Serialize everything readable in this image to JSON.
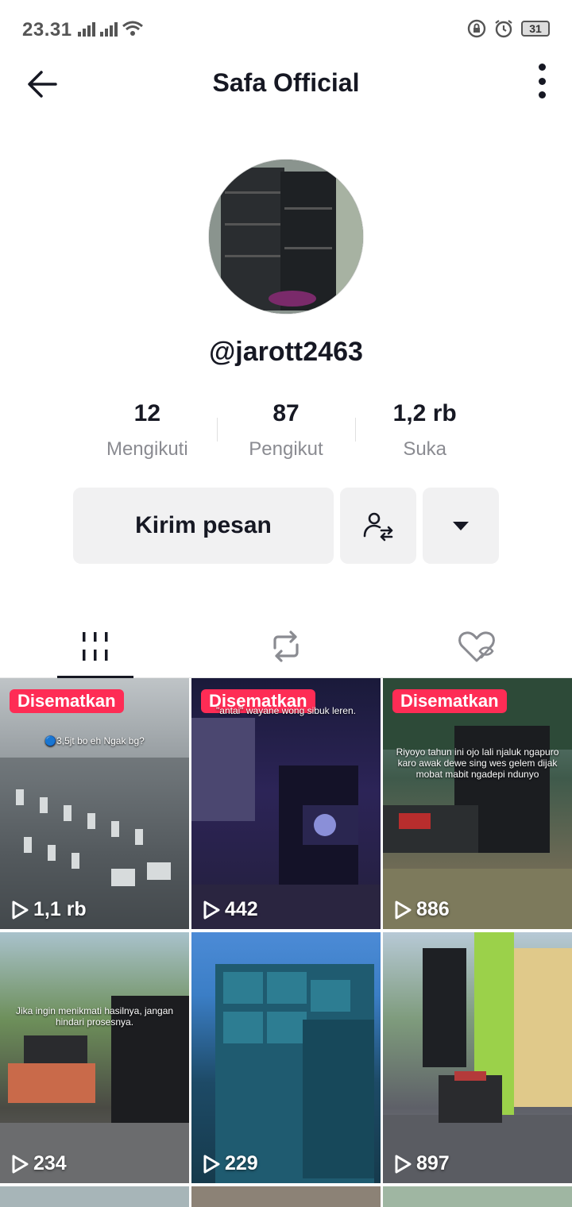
{
  "status_bar": {
    "time": "23.31",
    "battery": "31"
  },
  "header": {
    "title": "Safa Official"
  },
  "profile": {
    "username": "@jarott2463",
    "stats": [
      {
        "value": "12",
        "label": "Mengikuti"
      },
      {
        "value": "87",
        "label": "Pengikut"
      },
      {
        "value": "1,2 rb",
        "label": "Suka"
      }
    ]
  },
  "actions": {
    "message_label": "Kirim pesan"
  },
  "videos": [
    {
      "pinned": "Disematkan",
      "views": "1,1 rb",
      "caption": "🔵3,5jt bo eh Ngak bg?"
    },
    {
      "pinned": "Disematkan",
      "views": "442",
      "caption": "\"antai\" wayane wong sibuk leren."
    },
    {
      "pinned": "Disematkan",
      "views": "886",
      "caption": "Riyoyo tahun ini ojo lali njaluk ngapuro karo awak dewe sing wes gelem dijak mobat mabit ngadepi ndunyo"
    },
    {
      "pinned": "",
      "views": "234",
      "caption": "Jika ingin menikmati hasilnya, jangan hindari prosesnya."
    },
    {
      "pinned": "",
      "views": "229",
      "caption": ""
    },
    {
      "pinned": "",
      "views": "897",
      "caption": ""
    }
  ],
  "colors": {
    "accent": "#fe2c55",
    "text": "#161823",
    "muted": "#8a8b91",
    "button_bg": "#f1f1f2"
  }
}
